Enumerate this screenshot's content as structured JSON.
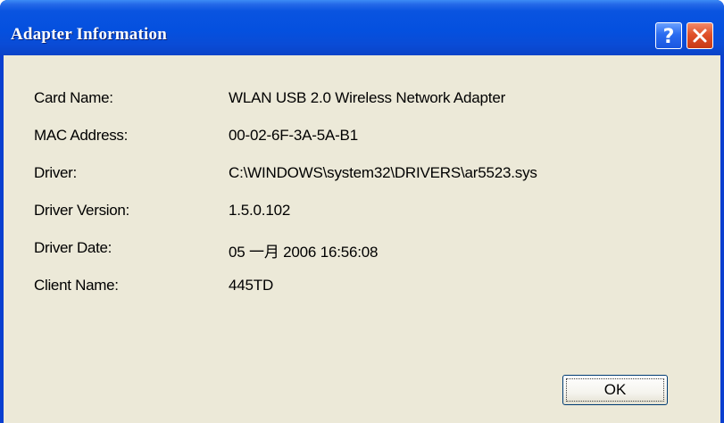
{
  "window": {
    "title": "Adapter Information",
    "help_icon": "help-icon",
    "close_icon": "close-icon"
  },
  "fields": [
    {
      "label": "Card Name:",
      "value": "WLAN USB 2.0 Wireless Network Adapter"
    },
    {
      "label": "MAC Address:",
      "value": "00-02-6F-3A-5A-B1"
    },
    {
      "label": "Driver:",
      "value": "C:\\WINDOWS\\system32\\DRIVERS\\ar5523.sys"
    },
    {
      "label": "Driver Version:",
      "value": "1.5.0.102"
    },
    {
      "label": "Driver Date:",
      "value": "05 一月 2006 16:56:08"
    },
    {
      "label": "Client Name:",
      "value": "445TD"
    }
  ],
  "buttons": {
    "ok_label": "OK"
  },
  "colors": {
    "titlebar": "#0450df",
    "frame": "#0a3fd0",
    "client_bg": "#ece9d8",
    "close_button": "#e0512a",
    "help_button": "#2a6cf0"
  }
}
